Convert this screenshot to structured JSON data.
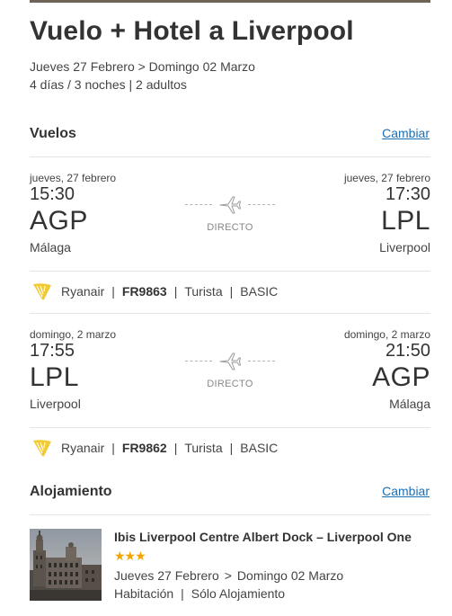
{
  "header": {
    "title": "Vuelo + Hotel a Liverpool",
    "dates": "Jueves 27 Febrero > Domingo 02 Marzo",
    "meta": "4 días / 3 noches | 2 adultos"
  },
  "flights_section": {
    "title": "Vuelos",
    "change_label": "Cambiar",
    "flights": [
      {
        "departure": {
          "date": "jueves, 27 febrero",
          "time": "15:30",
          "code": "AGP",
          "city": "Málaga"
        },
        "arrival": {
          "date": "jueves, 27 febrero",
          "time": "17:30",
          "code": "LPL",
          "city": "Liverpool"
        },
        "route_label": "DIRECTO",
        "airline": "Ryanair",
        "flight_number": "FR9863",
        "cabin": "Turista",
        "fare": "BASIC",
        "plane_icon": "airplane-icon",
        "airline_icon": "ryanair-harp-logo"
      },
      {
        "departure": {
          "date": "domingo, 2 marzo",
          "time": "17:55",
          "code": "LPL",
          "city": "Liverpool"
        },
        "arrival": {
          "date": "domingo, 2 marzo",
          "time": "21:50",
          "code": "AGP",
          "city": "Málaga"
        },
        "route_label": "DIRECTO",
        "airline": "Ryanair",
        "flight_number": "FR9862",
        "cabin": "Turista",
        "fare": "BASIC",
        "plane_icon": "airplane-icon",
        "airline_icon": "ryanair-harp-logo"
      }
    ]
  },
  "accommodation_section": {
    "title": "Alojamiento",
    "change_label": "Cambiar",
    "hotel": {
      "name": "Ibis Liverpool Centre Albert Dock – Liverpool One",
      "stars": "★★★",
      "star_rating": 3,
      "check_in": "Jueves 27 Febrero",
      "date_separator": ">",
      "check_out": "Domingo 02 Marzo",
      "room": "Habitación",
      "board": "Sólo Alojamiento"
    }
  },
  "separators": {
    "pipe": "|"
  },
  "colors": {
    "link": "#1a6fb5",
    "star": "#f0a500",
    "ryanair_yellow": "#f1c933",
    "text": "#333333"
  }
}
